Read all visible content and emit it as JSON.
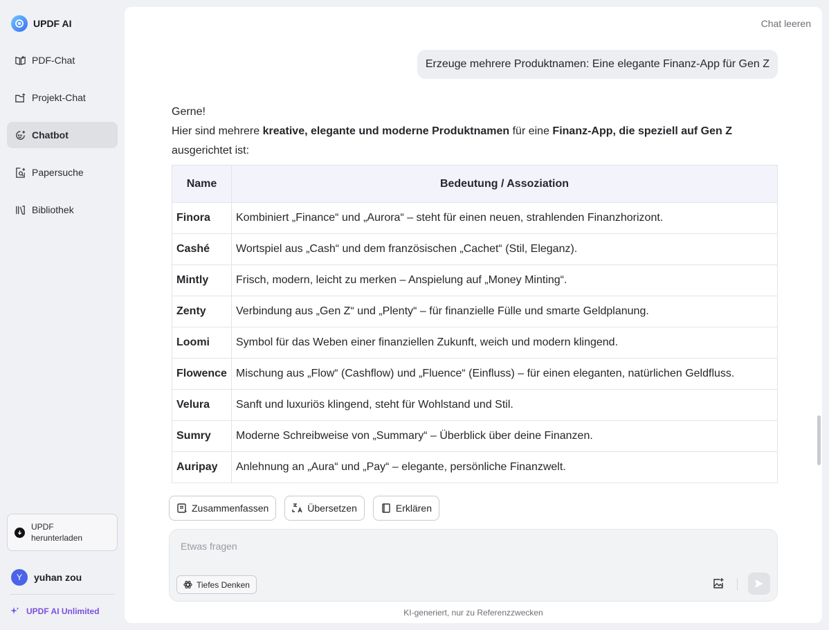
{
  "brand": {
    "name": "UPDF AI"
  },
  "sidebar": {
    "items": [
      {
        "label": "PDF-Chat",
        "icon": "book-open-icon",
        "active": false
      },
      {
        "label": "Projekt-Chat",
        "icon": "folder-plus-icon",
        "active": false
      },
      {
        "label": "Chatbot",
        "icon": "chatbot-icon",
        "active": true
      },
      {
        "label": "Papersuche",
        "icon": "paper-search-icon",
        "active": false
      },
      {
        "label": "Bibliothek",
        "icon": "library-icon",
        "active": false
      }
    ],
    "download_label": "UPDF herunterladen",
    "user": {
      "initial": "Y",
      "name": "yuhan zou"
    },
    "unlimited_label": "UPDF AI Unlimited"
  },
  "header": {
    "clear_label": "Chat leeren"
  },
  "chat": {
    "user_message": "Erzeuge mehrere Produktnamen: Eine elegante Finanz-App für Gen Z",
    "answer": {
      "greeting": "Gerne!",
      "intro_1": "Hier sind mehrere ",
      "intro_bold_1": "kreative, elegante und moderne Produktnamen",
      "intro_2": " für eine ",
      "intro_bold_2": "Finanz-App, die speziell auf Gen Z",
      "intro_3": "ausgerichtet ist:"
    },
    "table": {
      "headers": [
        "Name",
        "Bedeutung / Assoziation"
      ],
      "rows": [
        {
          "name": "Finora",
          "meaning": "Kombiniert „Finance“ und „Aurora“ – steht für einen neuen, strahlenden Finanzhorizont."
        },
        {
          "name": "Cashé",
          "meaning": "Wortspiel aus „Cash“ und dem französischen „Cachet“ (Stil, Eleganz)."
        },
        {
          "name": "Mintly",
          "meaning": "Frisch, modern, leicht zu merken – Anspielung auf „Money Minting“."
        },
        {
          "name": "Zenty",
          "meaning": "Verbindung aus „Gen Z“ und „Plenty“ – für finanzielle Fülle und smarte Geldplanung."
        },
        {
          "name": "Loomi",
          "meaning": "Symbol für das Weben einer finanziellen Zukunft, weich und modern klingend."
        },
        {
          "name": "Flowence",
          "meaning": "Mischung aus „Flow“ (Cashflow) und „Fluence“ (Einfluss) – für einen eleganten, natürlichen Geldfluss."
        },
        {
          "name": "Velura",
          "meaning": "Sanft und luxuriös klingend, steht für Wohlstand und Stil."
        },
        {
          "name": "Sumry",
          "meaning": "Moderne Schreibweise von „Summary“ – Überblick über deine Finanzen."
        },
        {
          "name": "Auripay",
          "meaning": "Anlehnung an „Aura“ und „Pay“ – elegante, persönliche Finanzwelt."
        }
      ]
    }
  },
  "actions": {
    "summarize": "Zusammenfassen",
    "translate": "Übersetzen",
    "explain": "Erklären"
  },
  "input": {
    "placeholder": "Etwas fragen",
    "deep_thinking": "Tiefes Denken"
  },
  "footnote": "KI-generiert, nur zu Referenzzwecken"
}
